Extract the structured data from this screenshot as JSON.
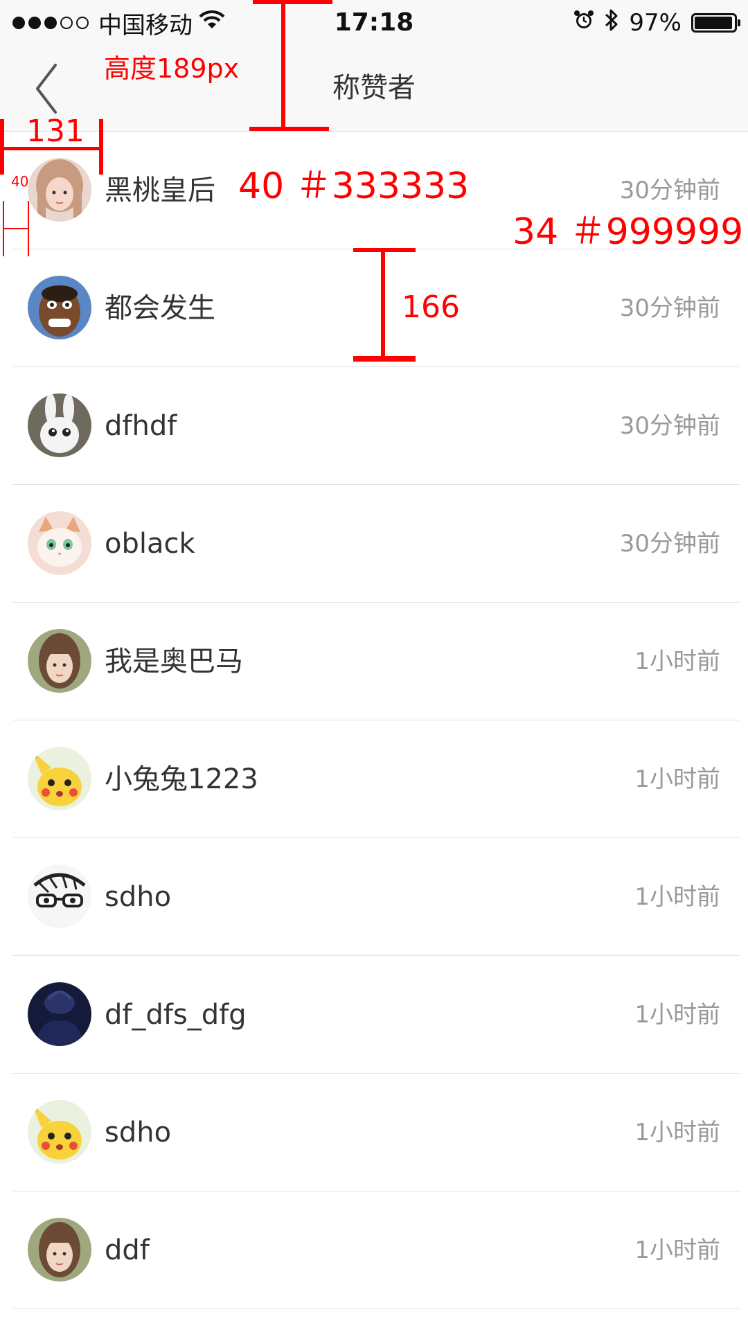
{
  "status_bar": {
    "carrier": "中国移动",
    "time": "17:18",
    "battery": "97%",
    "battery_level": 0.97
  },
  "nav": {
    "title": "称赞者"
  },
  "annotations": {
    "header_height": "高度189px",
    "avatar_left": "131",
    "avatar_margin": "40",
    "name_spec": "40 ＃333333",
    "time_spec": "34 ＃999999",
    "row_height": "166"
  },
  "colors": {
    "name": "#333333",
    "time": "#999999",
    "annotation": "#ff0000"
  },
  "list": [
    {
      "name": "黑桃皇后",
      "time": "30分钟前",
      "avatar": "girl-avatar-icon"
    },
    {
      "name": "都会发生",
      "time": "30分钟前",
      "avatar": "caricature-avatar-icon"
    },
    {
      "name": "dfhdf",
      "time": "30分钟前",
      "avatar": "rabbit-avatar-icon"
    },
    {
      "name": "oblack",
      "time": "30分钟前",
      "avatar": "cat-avatar-icon"
    },
    {
      "name": "我是奥巴马",
      "time": "1小时前",
      "avatar": "girl2-avatar-icon"
    },
    {
      "name": "小兔兔1223",
      "time": "1小时前",
      "avatar": "pikachu-avatar-icon"
    },
    {
      "name": "sdho",
      "time": "1小时前",
      "avatar": "sketch-avatar-icon"
    },
    {
      "name": "df_dfs_dfg",
      "time": "1小时前",
      "avatar": "dark-avatar-icon"
    },
    {
      "name": "sdho",
      "time": "1小时前",
      "avatar": "pikachu-avatar-icon"
    },
    {
      "name": "ddf",
      "time": "1小时前",
      "avatar": "girl2-avatar-icon"
    }
  ]
}
